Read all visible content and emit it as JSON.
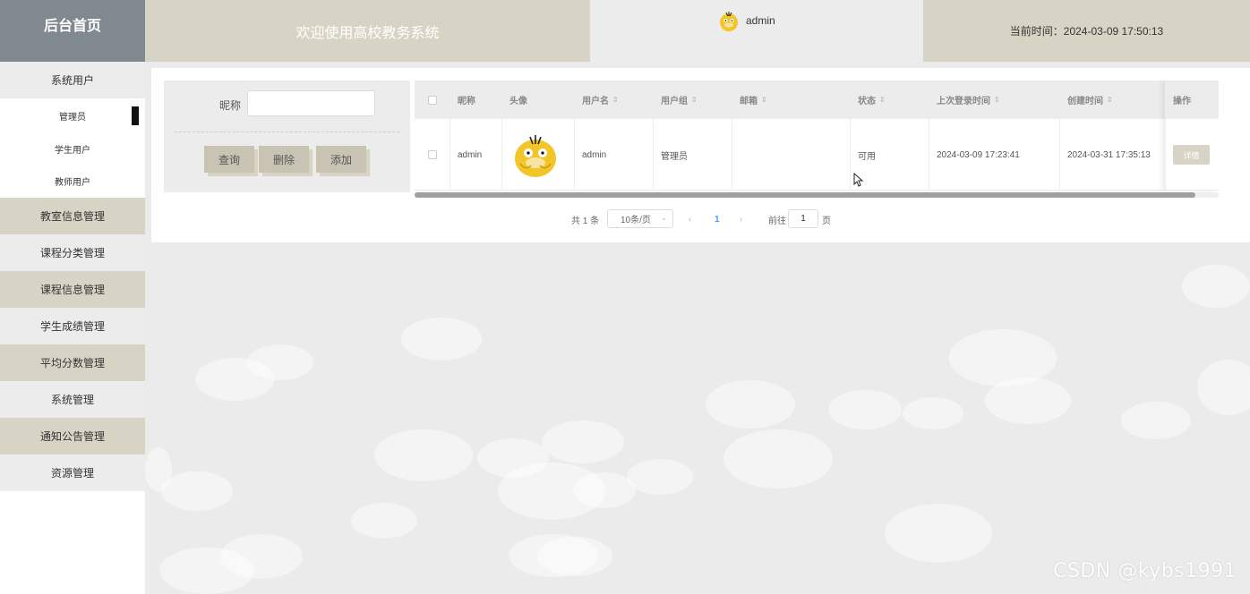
{
  "header": {
    "logo": "后台首页",
    "title": "欢迎使用高校教务系统",
    "username": "admin",
    "time_label": "当前时间：2024-03-09 17:50:13"
  },
  "sidebar": {
    "items": [
      {
        "label": "系统用户"
      },
      {
        "label": "管理员"
      },
      {
        "label": "学生用户"
      },
      {
        "label": "教师用户"
      },
      {
        "label": "教室信息管理"
      },
      {
        "label": "课程分类管理"
      },
      {
        "label": "课程信息管理"
      },
      {
        "label": "学生成绩管理"
      },
      {
        "label": "平均分数管理"
      },
      {
        "label": "系统管理"
      },
      {
        "label": "通知公告管理"
      },
      {
        "label": "资源管理"
      }
    ]
  },
  "search": {
    "nickname_label": "昵称",
    "nickname_value": "",
    "query_label": "查询",
    "delete_label": "删除",
    "add_label": "添加"
  },
  "table": {
    "columns": [
      "昵称",
      "头像",
      "用户名",
      "用户组",
      "邮箱",
      "状态",
      "上次登录时间",
      "创建时间",
      "操作"
    ],
    "rows": [
      {
        "nickname": "admin",
        "avatar": "psyduck-avatar-icon",
        "username": "admin",
        "group": "管理员",
        "email": "",
        "status": "可用",
        "last_login": "2024-03-09 17:23:41",
        "created": "2024-03-31 17:35:13",
        "action": "详情"
      }
    ]
  },
  "pagination": {
    "total": "共 1 条",
    "page_size": "10条/页",
    "current_page": "1",
    "goto_label": "前往",
    "goto_value": "1",
    "page_suffix": "页"
  },
  "watermark": "CSDN @kybs1991",
  "colors": {
    "sidebar_dark": "#d8d4c5",
    "sidebar_light": "#ececec",
    "logo_bg": "#808890",
    "button_bg": "#c9c3b3"
  }
}
